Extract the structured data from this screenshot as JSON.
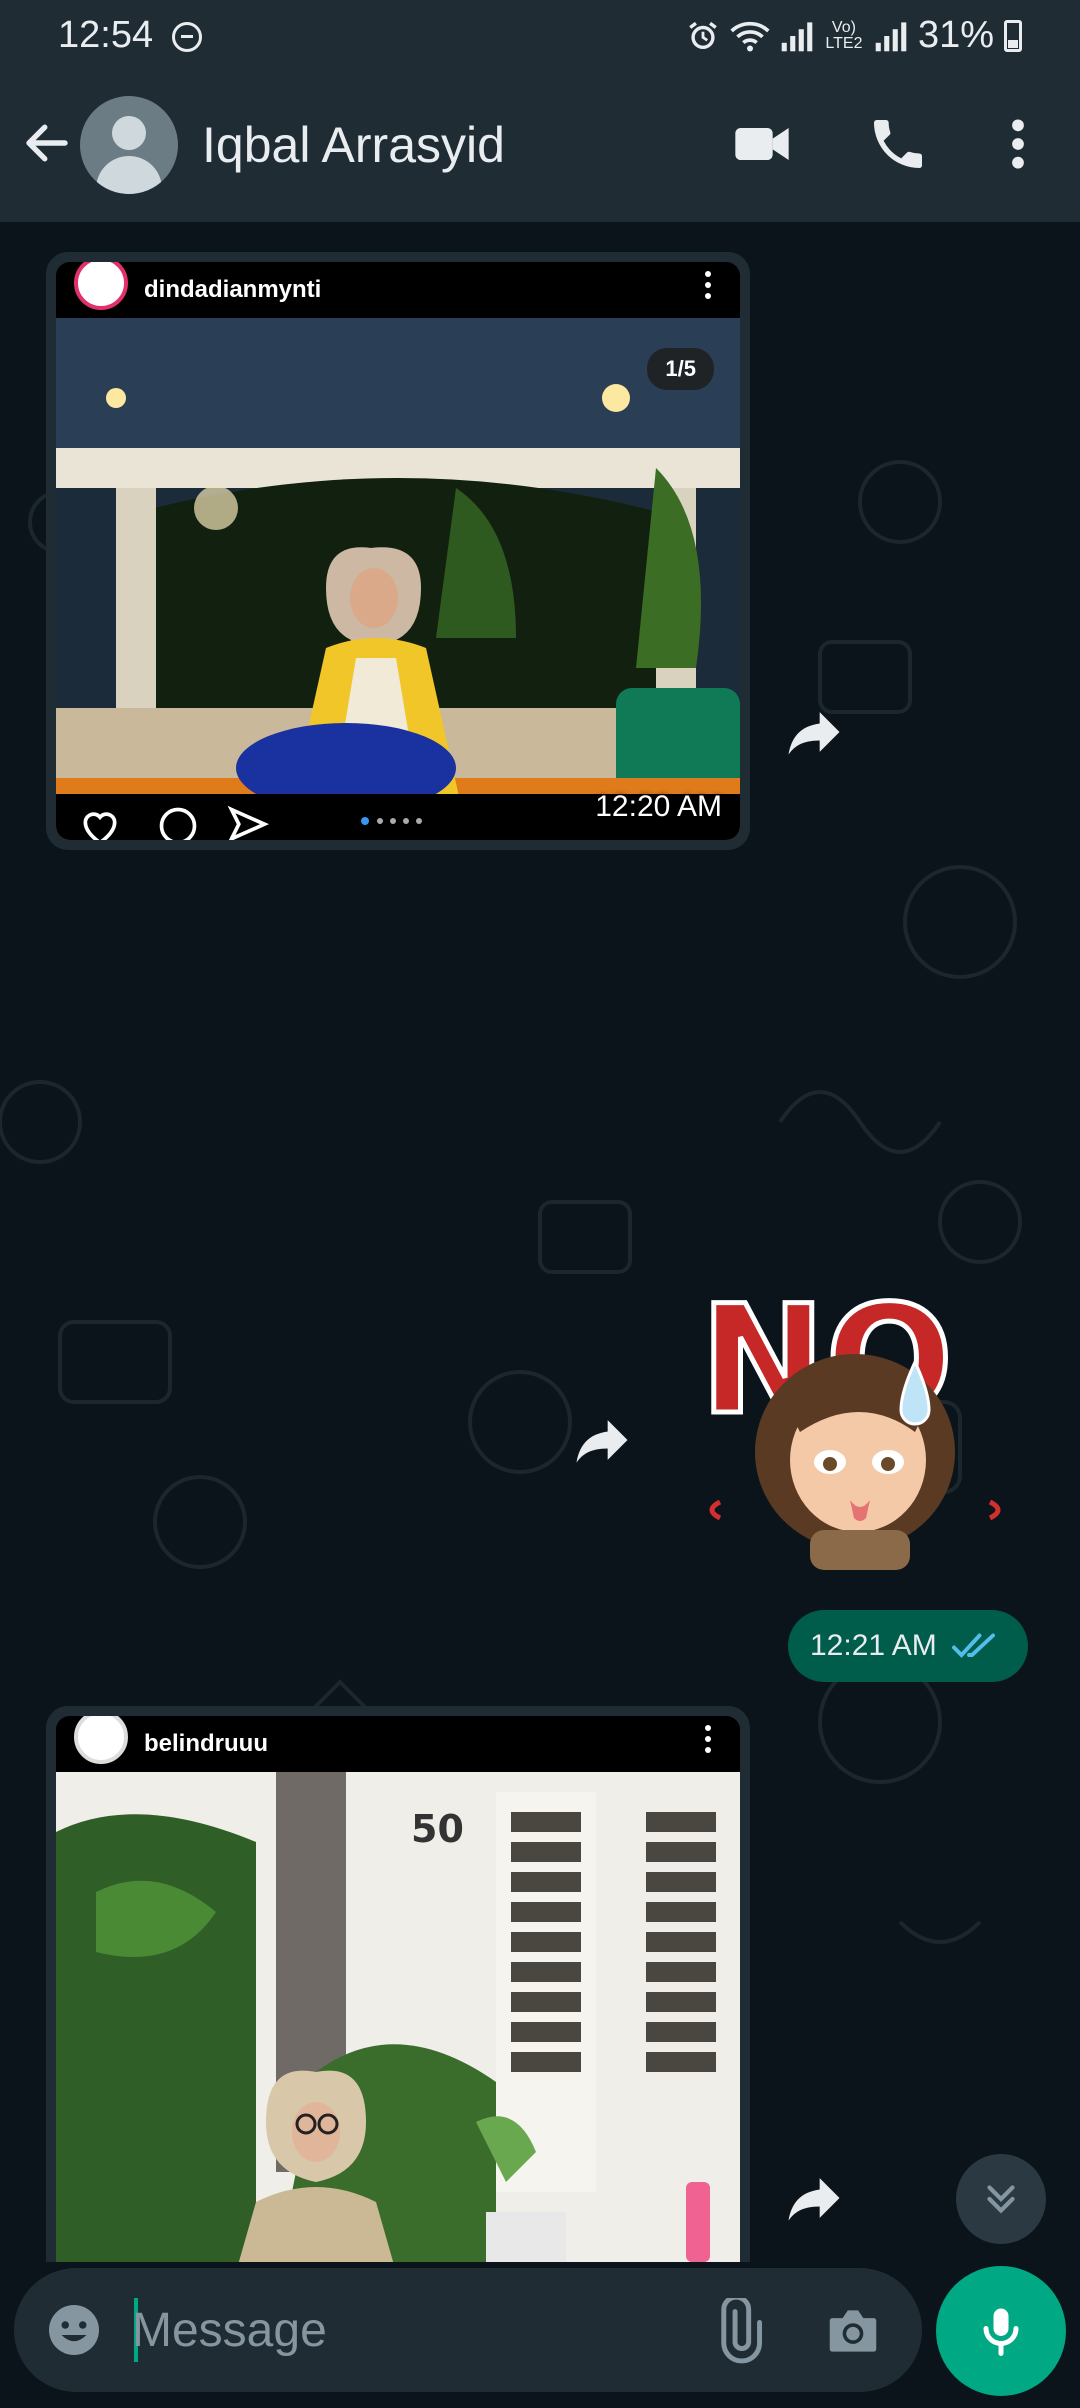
{
  "status_bar": {
    "time": "12:54",
    "battery": "31%",
    "network_label": "Vo) LTE2"
  },
  "header": {
    "contact_name": "Iqbal Arrasyid"
  },
  "messages": [
    {
      "type": "incoming-image",
      "ig_username": "dindadianmynti",
      "pager": "1/5",
      "time": "12:20 AM"
    },
    {
      "type": "outgoing-sticker",
      "sticker_text": "NO",
      "time": "12:21 AM"
    },
    {
      "type": "incoming-image",
      "ig_username": "belindruuu",
      "house_number": "50"
    }
  ],
  "input": {
    "placeholder": "Message"
  },
  "colors": {
    "header_bg": "#1f2c34",
    "chat_bg": "#0b141a",
    "outgoing_bubble": "#005c4b",
    "accent": "#00a884",
    "read_ticks": "#53bdeb"
  },
  "icons": [
    "back-arrow-icon",
    "video-call-icon",
    "phone-call-icon",
    "more-vert-icon",
    "forward-icon",
    "double-check-icon",
    "scroll-down-icon",
    "emoji-icon",
    "attach-icon",
    "camera-icon",
    "mic-icon"
  ]
}
